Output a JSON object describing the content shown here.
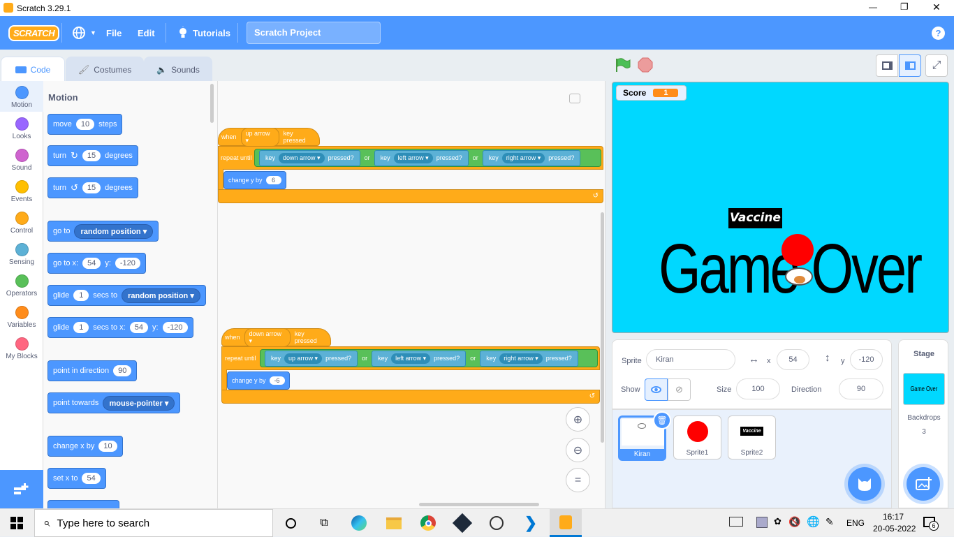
{
  "window": {
    "title": "Scratch 3.29.1",
    "minimize": "—",
    "maximize": "❐",
    "close": "✕"
  },
  "menubar": {
    "logo": "SCRATCH",
    "file": "File",
    "edit": "Edit",
    "tutorials": "Tutorials",
    "project_title": "Scratch Project",
    "help": "?"
  },
  "tabs": {
    "code": "Code",
    "costumes": "Costumes",
    "sounds": "Sounds"
  },
  "categories": [
    {
      "label": "Motion",
      "color": "#4c97ff"
    },
    {
      "label": "Looks",
      "color": "#9966ff"
    },
    {
      "label": "Sound",
      "color": "#cf63cf"
    },
    {
      "label": "Events",
      "color": "#ffbf00"
    },
    {
      "label": "Control",
      "color": "#ffab19"
    },
    {
      "label": "Sensing",
      "color": "#5cb1d6"
    },
    {
      "label": "Operators",
      "color": "#59c059"
    },
    {
      "label": "Variables",
      "color": "#ff8c1a"
    },
    {
      "label": "My Blocks",
      "color": "#ff6680"
    }
  ],
  "palette": {
    "heading": "Motion",
    "move": {
      "a": "move",
      "v": "10",
      "b": "steps"
    },
    "turn_r": {
      "a": "turn",
      "v": "15",
      "b": "degrees"
    },
    "turn_l": {
      "a": "turn",
      "v": "15",
      "b": "degrees"
    },
    "goto": {
      "a": "go to",
      "d": "random position"
    },
    "gotoxy": {
      "a": "go to x:",
      "x": "54",
      "b": "y:",
      "y": "-120"
    },
    "glide1": {
      "a": "glide",
      "v": "1",
      "b": "secs to",
      "d": "random position"
    },
    "glide2": {
      "a": "glide",
      "v": "1",
      "b": "secs to x:",
      "x": "54",
      "c": "y:",
      "y": "-120"
    },
    "point_dir": {
      "a": "point in direction",
      "v": "90"
    },
    "point_tow": {
      "a": "point towards",
      "d": "mouse-pointer"
    },
    "change_x": {
      "a": "change x by",
      "v": "10"
    },
    "set_x": {
      "a": "set x to",
      "v": "54"
    }
  },
  "scripts": {
    "s1": {
      "when": "when",
      "key": "up arrow",
      "pressed": "key pressed",
      "repeat": "repeat until",
      "k": "key",
      "k1": "down arrow",
      "p": "pressed?",
      "or": "or",
      "k2": "left arrow",
      "k3": "right arrow",
      "change": "change y by",
      "val": "6"
    },
    "s2": {
      "when": "when",
      "key": "down arrow",
      "pressed": "key pressed",
      "repeat": "repeat until",
      "k": "key",
      "k1": "up arrow",
      "p": "pressed?",
      "or": "or",
      "k2": "left arrow",
      "k3": "right arrow",
      "change": "change y by",
      "val": "-6"
    }
  },
  "stage": {
    "score_label": "Score",
    "score_value": "1",
    "vaccine": "Vaccine",
    "game_over": "Game Over"
  },
  "sprite_info": {
    "sprite_label": "Sprite",
    "sprite_name": "Kiran",
    "x_label": "x",
    "x": "54",
    "y_label": "y",
    "y": "-120",
    "show_label": "Show",
    "size_label": "Size",
    "size": "100",
    "direction_label": "Direction",
    "direction": "90"
  },
  "sprites": [
    "Kiran",
    "Sprite1",
    "Sprite2"
  ],
  "stage_pane": {
    "title": "Stage",
    "thumb_text": "Game Over",
    "backdrops_label": "Backdrops",
    "backdrops_count": "3"
  },
  "taskbar": {
    "search_placeholder": "Type here to search",
    "lang": "ENG",
    "time": "16:17",
    "date": "20-05-2022",
    "notif": "6"
  }
}
